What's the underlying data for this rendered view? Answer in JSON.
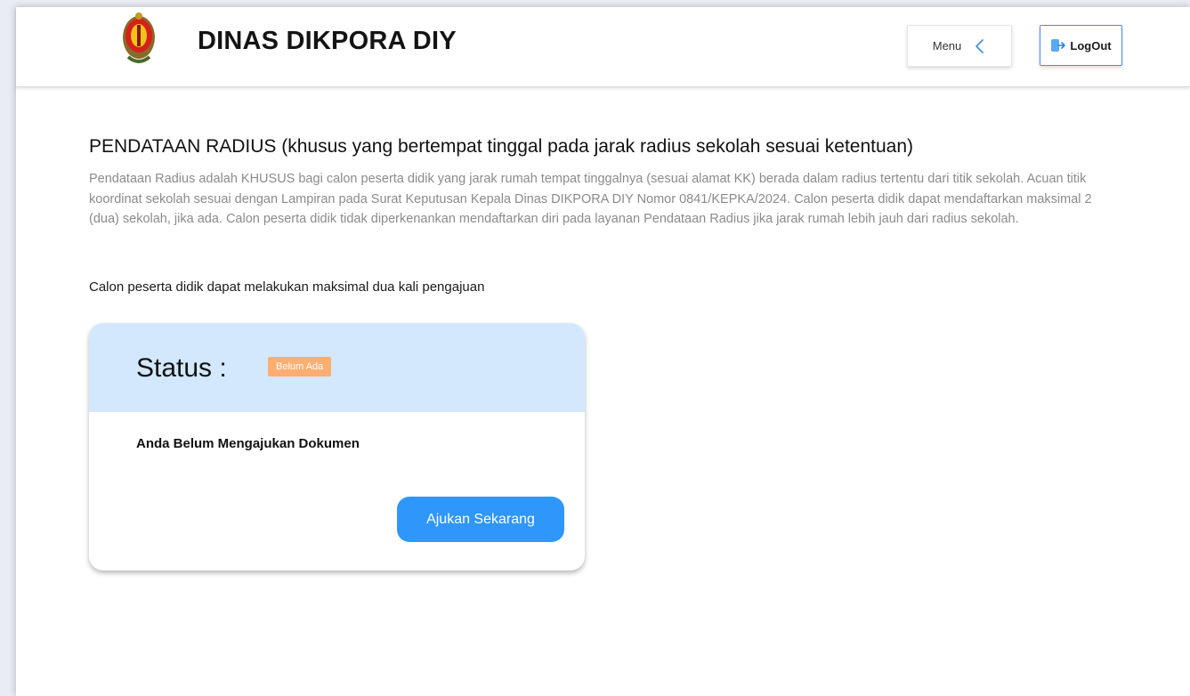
{
  "header": {
    "brand": "DINAS DIKPORA DIY",
    "menu_label": "Menu",
    "logout_label": "LogOut"
  },
  "main": {
    "title": "PENDATAAN RADIUS (khusus yang bertempat tinggal pada jarak radius sekolah sesuai ketentuan)",
    "description": "Pendataan Radius adalah KHUSUS bagi calon peserta didik yang jarak rumah tempat tinggalnya (sesuai alamat KK) berada dalam radius tertentu dari titik sekolah. Acuan titik koordinat sekolah sesuai dengan Lampiran pada Surat Keputusan Kepala Dinas DIKPORA DIY Nomor 0841/KEPKA/2024. Calon peserta didik dapat mendaftarkan maksimal 2 (dua) sekolah, jika ada. Calon peserta didik tidak diperkenankan mendaftarkan diri pada layanan Pendataan Radius jika jarak rumah lebih jauh dari radius sekolah.",
    "note": "Calon peserta didik dapat melakukan maksimal dua kali pengajuan"
  },
  "status_card": {
    "label": "Status :",
    "badge": "Belum Ada",
    "message": "Anda Belum Mengajukan Dokumen",
    "button": "Ajukan Sekarang"
  },
  "colors": {
    "card_header_bg": "#d3e8fd",
    "badge_bg": "#ffae71",
    "primary_button": "#2f96fa",
    "logout_border": "#4a90e2"
  },
  "icons": {
    "logo": "emblem-logo",
    "menu": "chevron-left-icon",
    "logout": "logout-icon"
  }
}
